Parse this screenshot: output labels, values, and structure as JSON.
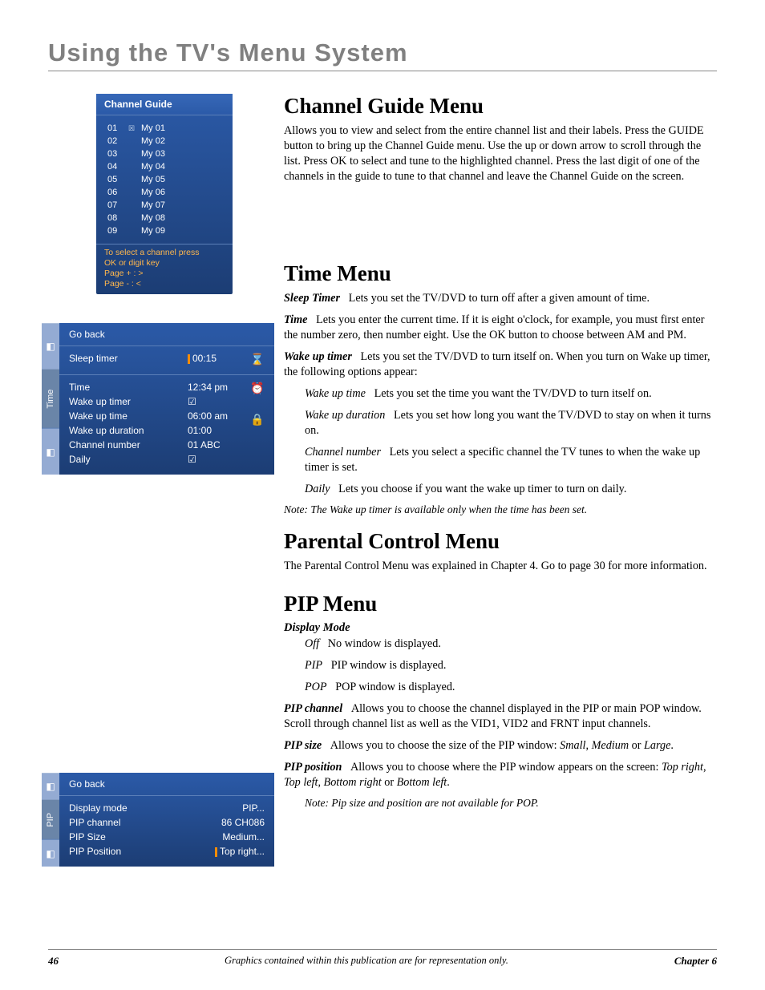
{
  "chapter_title": "Using the TV's Menu System",
  "channel_guide_shot": {
    "title": "Channel Guide",
    "rows": [
      {
        "n": "01",
        "tick": true,
        "label": "My 01"
      },
      {
        "n": "02",
        "tick": false,
        "label": "My 02"
      },
      {
        "n": "03",
        "tick": false,
        "label": "My 03"
      },
      {
        "n": "04",
        "tick": false,
        "label": "My 04"
      },
      {
        "n": "05",
        "tick": false,
        "label": "My 05"
      },
      {
        "n": "06",
        "tick": false,
        "label": "My 06"
      },
      {
        "n": "07",
        "tick": false,
        "label": "My 07"
      },
      {
        "n": "08",
        "tick": false,
        "label": "My 08"
      },
      {
        "n": "09",
        "tick": false,
        "label": "My 09"
      }
    ],
    "hint_line1": "To select a channel press",
    "hint_line2": "OK or digit key",
    "hint_line3": "Page + : >",
    "hint_line4": "Page - : <"
  },
  "time_menu_shot": {
    "tab_label": "Time",
    "goback": "Go back",
    "sleep_label": "Sleep timer",
    "sleep_value": "00:15",
    "rows": [
      {
        "label": "Time",
        "value": "12:34 pm"
      },
      {
        "label": "Wake up timer",
        "value": "☑"
      },
      {
        "label": "Wake up time",
        "value": "06:00 am"
      },
      {
        "label": "Wake up duration",
        "value": "01:00"
      },
      {
        "label": "Channel number",
        "value": "01 ABC"
      },
      {
        "label": "Daily",
        "value": "☑"
      }
    ],
    "icons": {
      "hourglass": "⌛",
      "clock": "⏰",
      "lock": "🔒"
    }
  },
  "pip_menu_shot": {
    "tab_label": "PIP",
    "goback": "Go back",
    "rows": [
      {
        "label": "Display mode",
        "value": "PIP..."
      },
      {
        "label": "PIP channel",
        "value": "86  CH086"
      },
      {
        "label": "PIP Size",
        "value": "Medium..."
      },
      {
        "label": "PIP Position",
        "value": "Top right..."
      }
    ]
  },
  "sections": {
    "cg": {
      "title": "Channel Guide Menu",
      "body": "Allows you to view and select from the entire channel list and their labels. Press the GUIDE button to bring up the Channel Guide menu. Use the up or down arrow to scroll through the list. Press OK to select and tune to the highlighted channel. Press the last digit of one of the channels in the guide to tune to that channel and leave the Channel Guide on the screen."
    },
    "time": {
      "title": "Time Menu",
      "sleep_label": "Sleep Timer",
      "sleep_body": "Lets you set the TV/DVD to turn off after a given amount of time.",
      "time_label": "Time",
      "time_body": "Lets you enter the current time. If it is eight o'clock, for example, you must first enter the number zero, then number eight. Use the OK button to choose between AM and PM.",
      "wut_label": "Wake up timer",
      "wut_body": "Lets you set the TV/DVD to turn itself on. When you turn on Wake up timer, the following options appear:",
      "wutime_label": "Wake up time",
      "wutime_body": "Lets you set the time you want the TV/DVD to turn itself on.",
      "wudur_label": "Wake up duration",
      "wudur_body": "Lets you set how long you want the TV/DVD to stay on when it turns on.",
      "chn_label": "Channel number",
      "chn_body": "Lets you select a specific channel the TV tunes to when the wake up timer is set.",
      "daily_label": "Daily",
      "daily_body": "Lets you choose if you want the wake up timer to turn on daily.",
      "note": "Note: The Wake up timer is available only when the time has been set."
    },
    "parental": {
      "title": "Parental Control Menu",
      "body": "The Parental Control Menu was explained in Chapter 4. Go to page 30 for more information."
    },
    "pip": {
      "title": "PIP Menu",
      "dm_label": "Display Mode",
      "off_label": "Off",
      "off_body": "No window is displayed.",
      "pip_label": "PIP",
      "pip_body": "PIP window is displayed.",
      "pop_label": "POP",
      "pop_body": "POP window is displayed.",
      "pipch_label": "PIP channel",
      "pipch_body": "Allows you to choose the channel displayed in the PIP or main POP window. Scroll through channel list as well as the VID1, VID2 and FRNT input channels.",
      "pipsize_label": "PIP size",
      "pipsize_body_a": "Allows you to choose the size of the PIP window: ",
      "pipsize_small": "Small",
      "pipsize_med": "Medium",
      "pipsize_lg": "Large",
      "pippos_label": "PIP position",
      "pippos_body_a": "Allows you to choose where the PIP window appears on the screen: ",
      "pippos_tr": "Top right",
      "pippos_tl": "Top left",
      "pippos_br": "Bottom right",
      "pippos_bl": "Bottom left",
      "note": "Note: Pip size and position are not available for POP."
    }
  },
  "footer": {
    "page": "46",
    "mid": "Graphics contained within this publication are for representation only.",
    "chapter": "Chapter 6"
  }
}
